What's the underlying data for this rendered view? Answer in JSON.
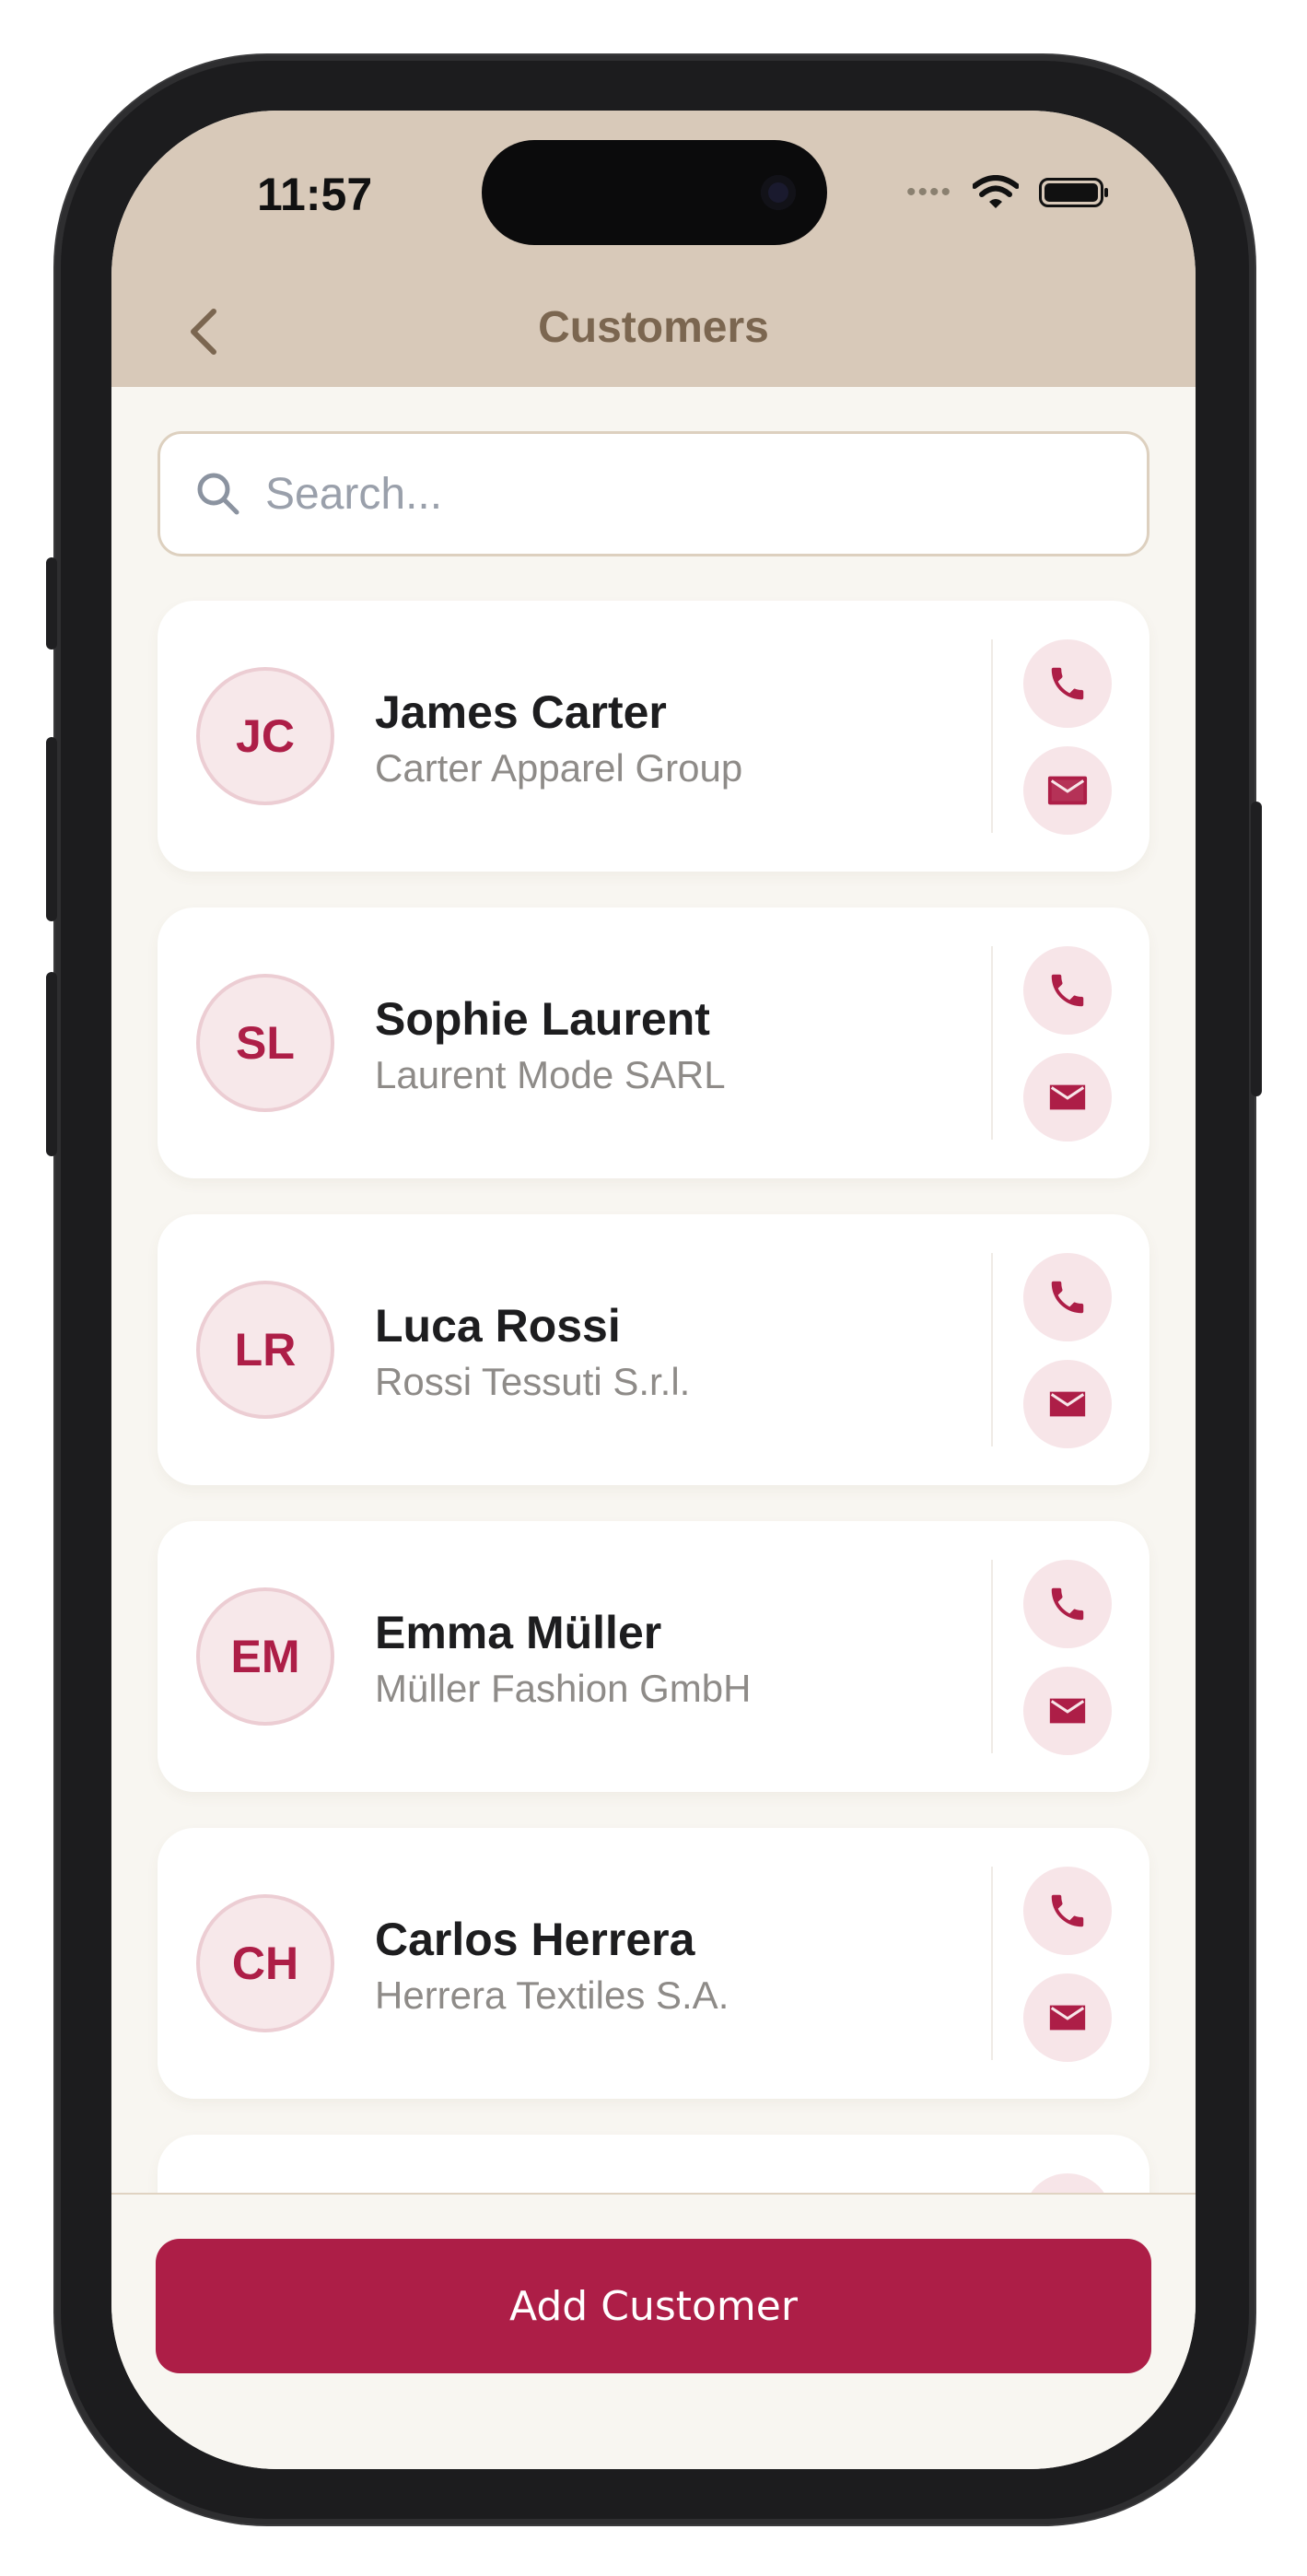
{
  "status_bar": {
    "time": "11:57"
  },
  "header": {
    "title": "Customers"
  },
  "search": {
    "placeholder": "Search..."
  },
  "customers": [
    {
      "initials": "JC",
      "name": "James Carter",
      "company": "Carter Apparel Group"
    },
    {
      "initials": "SL",
      "name": "Sophie Laurent",
      "company": "Laurent Mode SARL"
    },
    {
      "initials": "LR",
      "name": "Luca Rossi",
      "company": "Rossi Tessuti S.r.l."
    },
    {
      "initials": "EM",
      "name": "Emma Müller",
      "company": "Müller Fashion GmbH"
    },
    {
      "initials": "CH",
      "name": "Carlos Herrera",
      "company": "Herrera Textiles S.A."
    }
  ],
  "footer": {
    "add_label": "Add Customer"
  },
  "icons": {
    "back": "chevron-left-icon",
    "search": "search-icon",
    "call": "phone-icon",
    "email": "mail-icon"
  },
  "colors": {
    "accent": "#ad1e47",
    "header_bg": "#d8c9b9",
    "title": "#7b6650",
    "background": "#f8f6f1"
  }
}
